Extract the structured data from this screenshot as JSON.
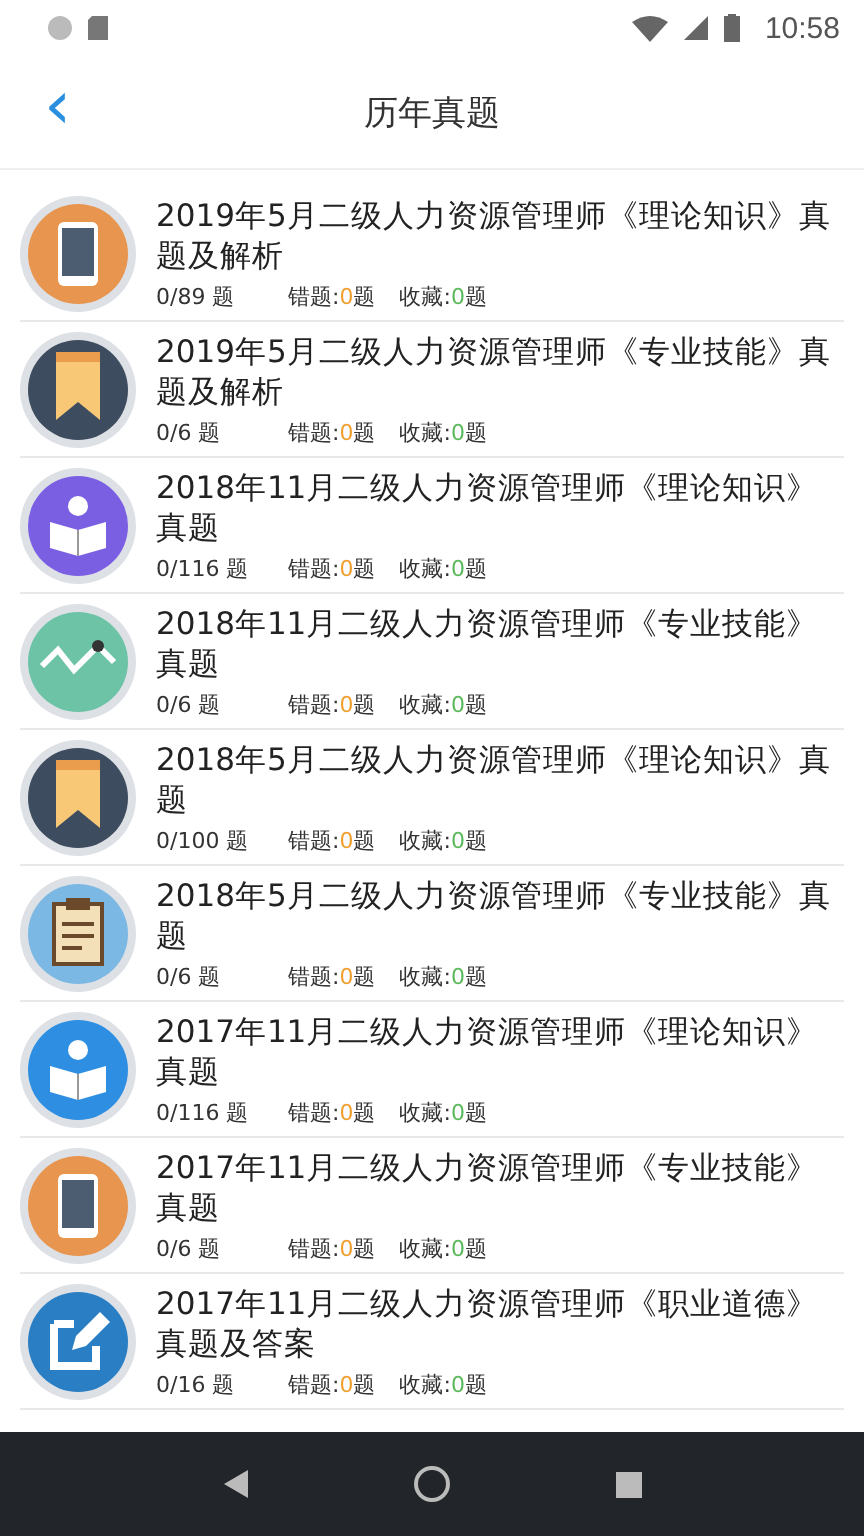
{
  "status_bar": {
    "time": "10:58"
  },
  "header": {
    "back": "‹",
    "title": "历年真题"
  },
  "items": [
    {
      "kind": "phone",
      "title": "2019年5月二级人力资源管理师《理论知识》真题及解析",
      "progress": "0/89 题",
      "wrong_label": "错题:",
      "wrong_count": "0",
      "wrong_unit": "题",
      "fav_label": "收藏:",
      "fav_count": "0",
      "fav_unit": "题"
    },
    {
      "kind": "bookmark",
      "title": "2019年5月二级人力资源管理师《专业技能》真题及解析",
      "progress": "0/6 题",
      "wrong_label": "错题:",
      "wrong_count": "0",
      "wrong_unit": "题",
      "fav_label": "收藏:",
      "fav_count": "0",
      "fav_unit": "题"
    },
    {
      "kind": "reader",
      "title": "2018年11月二级人力资源管理师《理论知识》真题",
      "progress": "0/116 题",
      "wrong_label": "错题:",
      "wrong_count": "0",
      "wrong_unit": "题",
      "fav_label": "收藏:",
      "fav_count": "0",
      "fav_unit": "题"
    },
    {
      "kind": "chart",
      "title": "2018年11月二级人力资源管理师《专业技能》真题",
      "progress": "0/6 题",
      "wrong_label": "错题:",
      "wrong_count": "0",
      "wrong_unit": "题",
      "fav_label": "收藏:",
      "fav_count": "0",
      "fav_unit": "题"
    },
    {
      "kind": "bookmark",
      "title": "2018年5月二级人力资源管理师《理论知识》真题",
      "progress": "0/100 题",
      "wrong_label": "错题:",
      "wrong_count": "0",
      "wrong_unit": "题",
      "fav_label": "收藏:",
      "fav_count": "0",
      "fav_unit": "题"
    },
    {
      "kind": "clipboard",
      "title": "2018年5月二级人力资源管理师《专业技能》真题",
      "progress": "0/6 题",
      "wrong_label": "错题:",
      "wrong_count": "0",
      "wrong_unit": "题",
      "fav_label": "收藏:",
      "fav_count": "0",
      "fav_unit": "题"
    },
    {
      "kind": "reader2",
      "title": "2017年11月二级人力资源管理师《理论知识》真题",
      "progress": "0/116 题",
      "wrong_label": "错题:",
      "wrong_count": "0",
      "wrong_unit": "题",
      "fav_label": "收藏:",
      "fav_count": "0",
      "fav_unit": "题"
    },
    {
      "kind": "phone",
      "title": "2017年11月二级人力资源管理师《专业技能》真题",
      "progress": "0/6 题",
      "wrong_label": "错题:",
      "wrong_count": "0",
      "wrong_unit": "题",
      "fav_label": "收藏:",
      "fav_count": "0",
      "fav_unit": "题"
    },
    {
      "kind": "edit",
      "title": "2017年11月二级人力资源管理师《职业道德》真题及答案",
      "progress": "0/16 题",
      "wrong_label": "错题:",
      "wrong_count": "0",
      "wrong_unit": "题",
      "fav_label": "收藏:",
      "fav_count": "0",
      "fav_unit": "题"
    }
  ]
}
